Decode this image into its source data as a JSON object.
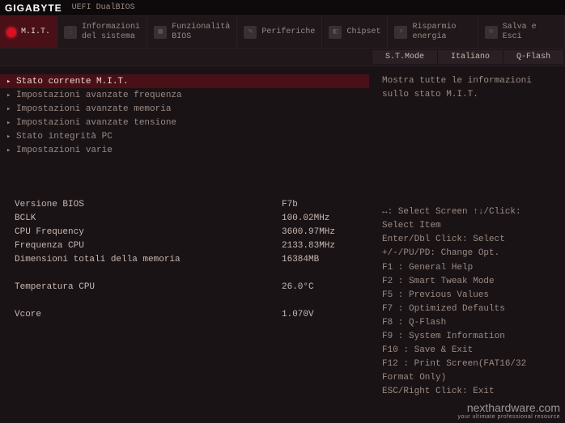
{
  "header": {
    "brand": "GIGABYTE",
    "subtitle": "UEFI DualBIOS"
  },
  "tabs": [
    {
      "label": "M.I.T.",
      "active": true
    },
    {
      "label": "Informazioni del sistema"
    },
    {
      "label": "Funzionalità BIOS"
    },
    {
      "label": "Periferiche"
    },
    {
      "label": "Chipset"
    },
    {
      "label": "Risparmio energia"
    },
    {
      "label": "Salva e Esci"
    }
  ],
  "toolbar": {
    "stmode": "S.T.Mode",
    "lang": "Italiano",
    "qflash": "Q-Flash"
  },
  "menu": [
    {
      "label": "Stato corrente M.I.T.",
      "selected": true
    },
    {
      "label": "Impostazioni avanzate frequenza"
    },
    {
      "label": "Impostazioni avanzate memoria"
    },
    {
      "label": "Impostazioni avanzate tensione"
    },
    {
      "label": "Stato integrità PC"
    },
    {
      "label": "Impostazioni varie"
    }
  ],
  "info": [
    {
      "label": "Versione BIOS",
      "value": "F7b"
    },
    {
      "label": "BCLK",
      "value": "100.02MHz"
    },
    {
      "label": "CPU Frequency",
      "value": "3600.97MHz"
    },
    {
      "label": "Frequenza CPU",
      "value": "2133.83MHz"
    },
    {
      "label": "Dimensioni totali della memoria",
      "value": "16384MB"
    },
    {
      "label": "Temperatura CPU",
      "value": "26.0°C",
      "gap": true
    },
    {
      "label": "Vcore",
      "value": "1.070V",
      "gap": true
    }
  ],
  "description": "Mostra tutte le informazioni sullo stato M.I.T.",
  "help": [
    "↔: Select Screen  ↑↓/Click: Select Item",
    "Enter/Dbl Click: Select",
    "+/-/PU/PD: Change Opt.",
    "F1  : General Help",
    "F2  : Smart Tweak Mode",
    "F5  : Previous Values",
    "F7  : Optimized Defaults",
    "F8  : Q-Flash",
    "F9  : System Information",
    "F10 : Save & Exit",
    "F12 : Print Screen(FAT16/32 Format Only)",
    "ESC/Right Click: Exit"
  ],
  "watermark": {
    "main": "nexthardware.com",
    "sub": "your ultimate professional resource"
  }
}
